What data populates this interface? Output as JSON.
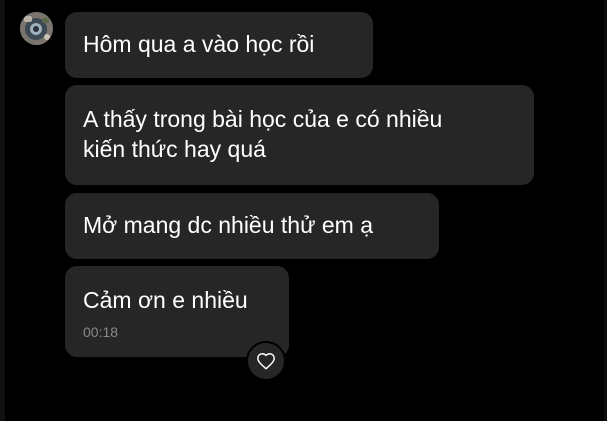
{
  "sender": {
    "avatar_icon": "profile-avatar"
  },
  "messages": [
    {
      "lines": [
        "Hôm qua a vào học rồi"
      ]
    },
    {
      "lines": [
        "A thấy trong bài học của e có nhiều",
        "kiến thức hay quá"
      ]
    },
    {
      "lines": [
        "Mở mang dc nhiều thử em ạ"
      ]
    },
    {
      "lines": [
        "Cảm ơn e nhiều"
      ],
      "time": "00:18"
    }
  ],
  "reaction": {
    "icon": "heart-icon"
  },
  "colors": {
    "background": "#000000",
    "bubble": "#262626",
    "text": "#ffffff",
    "timestamp": "#8a8a8a"
  }
}
